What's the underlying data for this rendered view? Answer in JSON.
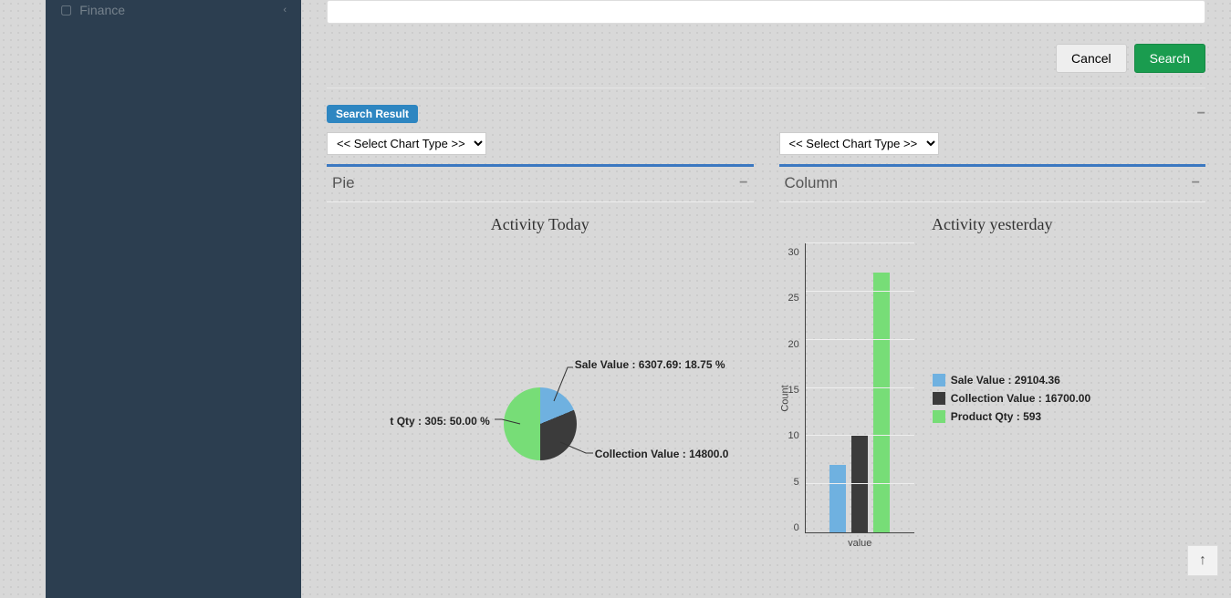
{
  "sidebar": {
    "items": [
      {
        "icon": "folder-icon",
        "label": "Finance"
      }
    ]
  },
  "actions": {
    "cancel": "Cancel",
    "search": "Search"
  },
  "result_badge": "Search Result",
  "collapse_glyph": "−",
  "chart_select_placeholder": "<< Select Chart Type >>",
  "left_panel": {
    "heading": "Pie",
    "title": "Activity Today"
  },
  "right_panel": {
    "heading": "Column",
    "title": "Activity yesterday"
  },
  "colors": {
    "blue": "#6fb1e0",
    "dark": "#3b3b3b",
    "green": "#77dd77"
  },
  "chart_data": [
    {
      "type": "pie",
      "title": "Activity Today",
      "series": [
        {
          "name": "Sale Value",
          "value": 6307.69,
          "percent": 18.75,
          "label": "Sale Value : 6307.69: 18.75 %",
          "color": "#6fb1e0"
        },
        {
          "name": "Collection Value",
          "value": 14800.0,
          "percent": 31.25,
          "label": "Collection Value : 14800.0",
          "color": "#3b3b3b"
        },
        {
          "name": "Product Qty",
          "value": 305,
          "percent": 50.0,
          "label": "t Qty : 305: 50.00 %",
          "color": "#77dd77"
        }
      ]
    },
    {
      "type": "bar",
      "title": "Activity yesterday",
      "ylabel": "Count",
      "xlabel": "value",
      "ylim": [
        0,
        30
      ],
      "ticks": [
        0,
        5,
        10,
        15,
        20,
        25,
        30
      ],
      "categories": [
        "value"
      ],
      "series": [
        {
          "name": "Sale Value",
          "raw": 29104.36,
          "plotted": 7,
          "legend": "Sale Value : 29104.36",
          "color": "#6fb1e0"
        },
        {
          "name": "Collection Value",
          "raw": 16700.0,
          "plotted": 10,
          "legend": "Collection Value : 16700.00",
          "color": "#3b3b3b"
        },
        {
          "name": "Product Qty",
          "raw": 593,
          "plotted": 27,
          "legend": "Product Qty : 593",
          "color": "#77dd77"
        }
      ]
    }
  ],
  "scroll_top_glyph": "↑"
}
